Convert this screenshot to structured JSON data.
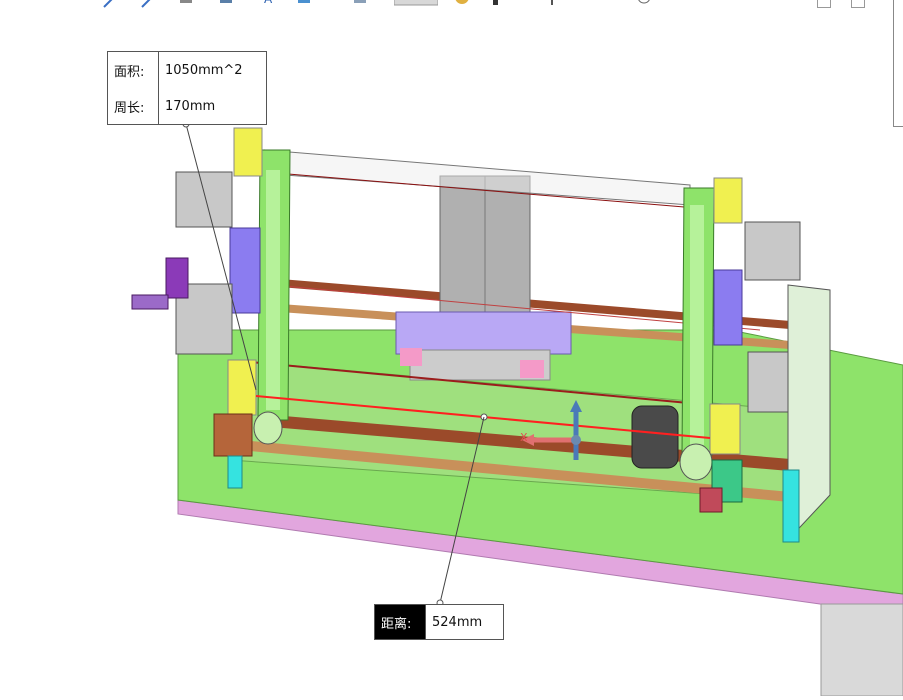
{
  "toolbar": {
    "icons": [
      "sketch-line-icon",
      "sketch-arc-icon",
      "smart-dimension-icon",
      "edit-sketch-icon",
      "text-annotation-icon",
      "shade-icon",
      "material-icon",
      "section-view-icon",
      "appearance-icon",
      "display-style-icon",
      "normal-to-icon",
      "rotate-view-icon",
      "section-icon"
    ]
  },
  "measure": {
    "area_label": "面积:",
    "area_value": "1050mm^2",
    "perimeter_label": "周长:",
    "perimeter_value": "170mm",
    "distance_label": "距离:",
    "distance_value": "524mm"
  },
  "triad": {
    "x_label": "X"
  },
  "colors": {
    "frame_green": "#8ee36a",
    "light_green": "#a8f08a",
    "base_pink": "#e2a6de",
    "cyan": "#35e3e0",
    "purple": "#8b7cf0",
    "yellow": "#f0f050",
    "rod_brown": "#9b4a2a",
    "rod_tan": "#c8905a",
    "measure_red": "#ff2020"
  }
}
